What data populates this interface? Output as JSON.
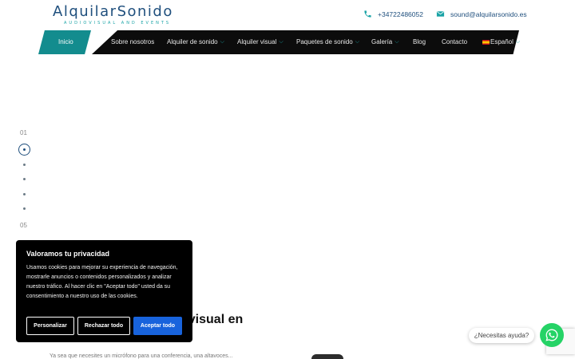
{
  "brand": {
    "logo_text": "AlquilarSonido",
    "logo_tagline": "AUDIOVISUAL AND EVENTS",
    "accent": "#1aa3a6",
    "primary": "#1f4f7d"
  },
  "contact": {
    "phone": "+34722486052",
    "email": "sound@alquilarsonido.es"
  },
  "nav": {
    "items": [
      {
        "label": "Inicio"
      },
      {
        "label": "Sobre nosotros"
      },
      {
        "label": "Alquiler de sonido"
      },
      {
        "label": "Alquiler visual"
      },
      {
        "label": "Paquetes de sonido"
      },
      {
        "label": "Galería"
      },
      {
        "label": "Blog"
      },
      {
        "label": "Contacto"
      },
      {
        "label": "Español"
      }
    ]
  },
  "slider": {
    "first": "01",
    "last": "05"
  },
  "hero": {
    "heading_fragment": "ovisual en",
    "body_fragment": "Ya sea que necesites un micrófono para una conferencia, una altavoces..."
  },
  "cookie": {
    "title": "Valoramos tu privacidad",
    "text": "Usamos cookies para mejorar su experiencia de navegación, mostrarle anuncios o contenidos personalizados y analizar nuestro tráfico. Al hacer clic en \"Aceptar todo\" usted da su consentimiento a nuestro uso de las cookies.",
    "customize": "Personalizar",
    "reject": "Rechazar todo",
    "accept": "Aceptar todo"
  },
  "whatsapp": {
    "help": "¿Necesitas ayuda?"
  }
}
